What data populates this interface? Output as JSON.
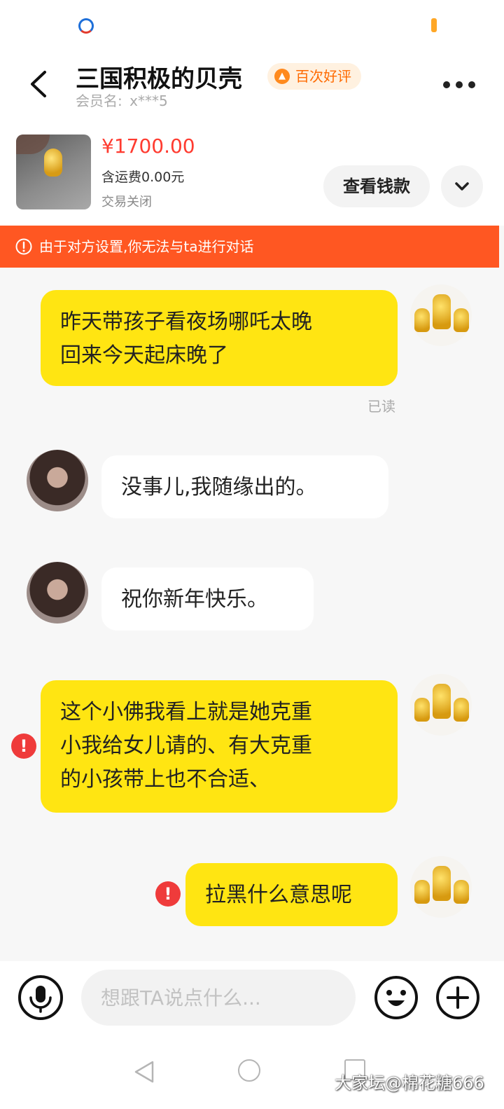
{
  "header": {
    "seller_name": "三国积极的贝壳",
    "badge": "百次好评",
    "member_label": "会员名:",
    "member_id": "x***5"
  },
  "order": {
    "price": "¥1700.00",
    "shipping": "含运费0.00元",
    "status": "交易关闭",
    "view_payment": "查看钱款"
  },
  "banner": {
    "text": "由于对方设置,你无法与ta进行对话"
  },
  "messages": [
    {
      "sender": "self",
      "text": "昨天带孩子看夜场哪吒太晚\n回来今天起床晚了",
      "read": "已读"
    },
    {
      "sender": "other",
      "text": "没事儿,我随缘出的。"
    },
    {
      "sender": "other",
      "text": "祝你新年快乐。"
    },
    {
      "sender": "self",
      "text": "这个小佛我看上就是她克重\n小我给女儿请的、有大克重\n的小孩带上也不合适、",
      "failed": true
    },
    {
      "sender": "self",
      "text": "拉黑什么意思呢",
      "failed": true
    }
  ],
  "input": {
    "placeholder": "想跟TA说点什么..."
  },
  "watermark": "大家坛@棉花糖666",
  "colors": {
    "self_bubble": "#ffe512",
    "banner": "#ff5722",
    "price": "#ff3b30",
    "error": "#ef3b3b"
  },
  "icons": [
    "back-icon",
    "more-icon",
    "chevron-down-icon",
    "warning-icon",
    "error-icon",
    "microphone-icon",
    "emoji-icon",
    "plus-icon"
  ]
}
